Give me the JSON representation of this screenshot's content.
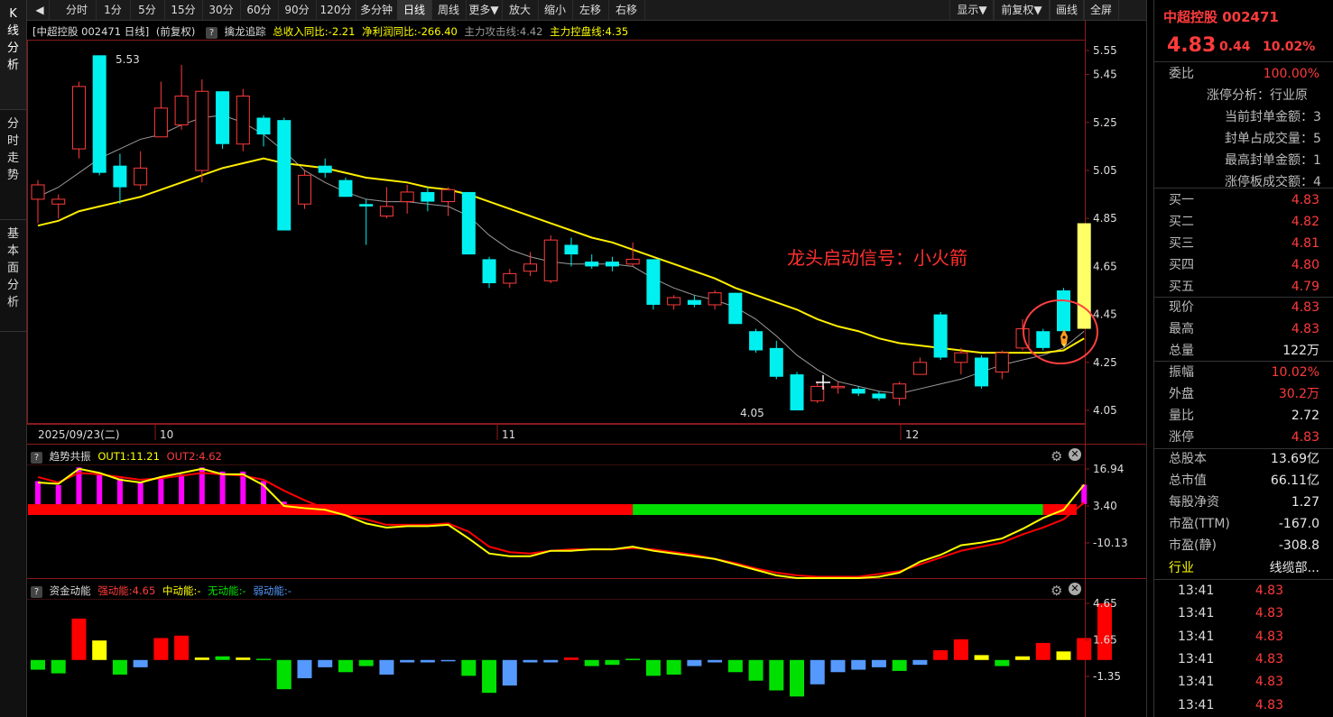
{
  "left_tabs": [
    "K线分析",
    "分时走势",
    "基本面分析"
  ],
  "toolbar": {
    "items": [
      "分时",
      "1分",
      "5分",
      "15分",
      "30分",
      "60分",
      "90分",
      "120分",
      "多分钟",
      "日线",
      "周线",
      "更多▼",
      "放大",
      "缩小",
      "左移",
      "右移"
    ],
    "right_items": [
      "显示▼",
      "前复权▼",
      "画线",
      "全屏"
    ],
    "active": "日线"
  },
  "main_header": {
    "title": "[中超控股 002471 日线]",
    "adjust": "(前复权)",
    "indicator": "擒龙追踪",
    "rev": "总收入同比:-2.21",
    "profit": "净利润同比:-266.40",
    "attack": "主力攻击线:4.42",
    "control": "主力控盘线:4.35"
  },
  "annotation": "龙头启动信号：小火箭",
  "price_axis": [
    "5.55",
    "5.45",
    "5.25",
    "5.05",
    "4.85",
    "4.65",
    "4.45",
    "4.25",
    "4.05"
  ],
  "high_label": "5.53",
  "low_label": "4.05",
  "date_axis": [
    "2025/09/23(二)",
    "10",
    "11",
    "12"
  ],
  "sub1_header": {
    "name": "趋势共振",
    "out1": "OUT1:11.21",
    "out2": "OUT2:4.62"
  },
  "sub1_axis": [
    "16.94",
    "3.40",
    "-10.13"
  ],
  "sub2_header": {
    "name": "资金动能",
    "strong": "强动能:4.65",
    "mid": "中动能:-",
    "none": "无动能:-",
    "weak": "弱动能:-"
  },
  "sub2_axis": [
    "4.65",
    "1.65",
    "-1.35"
  ],
  "colors": {
    "up": "#ff3b3b",
    "down": "#00f0f0",
    "ma_yellow": "#ffff00",
    "ma_gray": "#aaaaaa",
    "magenta": "#ff00ff",
    "green": "#00e000",
    "blue": "#5599ff"
  },
  "chart_data": {
    "type": "candlestick",
    "candles": [
      {
        "o": 4.93,
        "c": 4.99,
        "h": 5.01,
        "l": 4.83
      },
      {
        "o": 4.91,
        "c": 4.93,
        "h": 4.95,
        "l": 4.85
      },
      {
        "o": 5.14,
        "c": 5.4,
        "h": 5.42,
        "l": 5.1
      },
      {
        "o": 5.53,
        "c": 5.04,
        "h": 5.53,
        "l": 5.03
      },
      {
        "o": 5.07,
        "c": 4.98,
        "h": 5.12,
        "l": 4.91
      },
      {
        "o": 4.99,
        "c": 5.06,
        "h": 5.13,
        "l": 4.97
      },
      {
        "o": 5.19,
        "c": 5.31,
        "h": 5.42,
        "l": 5.19
      },
      {
        "o": 5.24,
        "c": 5.36,
        "h": 5.49,
        "l": 5.22
      },
      {
        "o": 5.05,
        "c": 5.38,
        "h": 5.43,
        "l": 5.0
      },
      {
        "o": 5.38,
        "c": 5.16,
        "h": 5.38,
        "l": 5.14
      },
      {
        "o": 5.16,
        "c": 5.36,
        "h": 5.39,
        "l": 5.13
      },
      {
        "o": 5.27,
        "c": 5.2,
        "h": 5.28,
        "l": 5.15
      },
      {
        "o": 5.26,
        "c": 4.8,
        "h": 5.27,
        "l": 4.8
      },
      {
        "o": 4.91,
        "c": 5.03,
        "h": 5.05,
        "l": 4.89
      },
      {
        "o": 5.07,
        "c": 5.04,
        "h": 5.1,
        "l": 5.02
      },
      {
        "o": 5.01,
        "c": 4.94,
        "h": 5.02,
        "l": 4.94
      },
      {
        "o": 4.91,
        "c": 4.9,
        "h": 4.93,
        "l": 4.74
      },
      {
        "o": 4.86,
        "c": 4.9,
        "h": 4.98,
        "l": 4.85
      },
      {
        "o": 4.92,
        "c": 4.96,
        "h": 4.99,
        "l": 4.87
      },
      {
        "o": 4.96,
        "c": 4.92,
        "h": 4.98,
        "l": 4.88
      },
      {
        "o": 4.92,
        "c": 4.97,
        "h": 4.98,
        "l": 4.86
      },
      {
        "o": 4.96,
        "c": 4.7,
        "h": 4.96,
        "l": 4.7
      },
      {
        "o": 4.68,
        "c": 4.58,
        "h": 4.69,
        "l": 4.56
      },
      {
        "o": 4.58,
        "c": 4.62,
        "h": 4.64,
        "l": 4.56
      },
      {
        "o": 4.63,
        "c": 4.66,
        "h": 4.71,
        "l": 4.61
      },
      {
        "o": 4.59,
        "c": 4.76,
        "h": 4.78,
        "l": 4.58
      },
      {
        "o": 4.74,
        "c": 4.7,
        "h": 4.77,
        "l": 4.65
      },
      {
        "o": 4.67,
        "c": 4.65,
        "h": 4.7,
        "l": 4.64
      },
      {
        "o": 4.67,
        "c": 4.65,
        "h": 4.69,
        "l": 4.63
      },
      {
        "o": 4.66,
        "c": 4.68,
        "h": 4.75,
        "l": 4.65
      },
      {
        "o": 4.68,
        "c": 4.49,
        "h": 4.68,
        "l": 4.47
      },
      {
        "o": 4.49,
        "c": 4.52,
        "h": 4.53,
        "l": 4.47
      },
      {
        "o": 4.51,
        "c": 4.49,
        "h": 4.53,
        "l": 4.48
      },
      {
        "o": 4.49,
        "c": 4.54,
        "h": 4.55,
        "l": 4.47
      },
      {
        "o": 4.54,
        "c": 4.41,
        "h": 4.54,
        "l": 4.41
      },
      {
        "o": 4.38,
        "c": 4.3,
        "h": 4.39,
        "l": 4.29
      },
      {
        "o": 4.31,
        "c": 4.19,
        "h": 4.34,
        "l": 4.18
      },
      {
        "o": 4.2,
        "c": 4.05,
        "h": 4.21,
        "l": 4.05
      },
      {
        "o": 4.09,
        "c": 4.15,
        "h": 4.17,
        "l": 4.08
      },
      {
        "o": 4.15,
        "c": 4.15,
        "h": 4.17,
        "l": 4.12
      },
      {
        "o": 4.14,
        "c": 4.12,
        "h": 4.15,
        "l": 4.11
      },
      {
        "o": 4.12,
        "c": 4.1,
        "h": 4.13,
        "l": 4.09
      },
      {
        "o": 4.1,
        "c": 4.16,
        "h": 4.17,
        "l": 4.07
      },
      {
        "o": 4.2,
        "c": 4.25,
        "h": 4.27,
        "l": 4.2
      },
      {
        "o": 4.45,
        "c": 4.27,
        "h": 4.46,
        "l": 4.26
      },
      {
        "o": 4.25,
        "c": 4.29,
        "h": 4.31,
        "l": 4.2
      },
      {
        "o": 4.27,
        "c": 4.15,
        "h": 4.28,
        "l": 4.14
      },
      {
        "o": 4.21,
        "c": 4.29,
        "h": 4.3,
        "l": 4.18
      },
      {
        "o": 4.31,
        "c": 4.39,
        "h": 4.43,
        "l": 4.3
      },
      {
        "o": 4.38,
        "c": 4.31,
        "h": 4.39,
        "l": 4.3
      },
      {
        "o": 4.55,
        "c": 4.38,
        "h": 4.56,
        "l": 4.37
      },
      {
        "o": 4.39,
        "c": 4.83,
        "h": 4.83,
        "l": 4.39
      }
    ],
    "ma_yellow": [
      4.82,
      4.84,
      4.88,
      4.9,
      4.92,
      4.94,
      4.97,
      5.0,
      5.03,
      5.06,
      5.08,
      5.1,
      5.08,
      5.07,
      5.06,
      5.04,
      5.02,
      5.01,
      5.0,
      4.98,
      4.97,
      4.95,
      4.92,
      4.89,
      4.86,
      4.83,
      4.8,
      4.77,
      4.75,
      4.72,
      4.69,
      4.66,
      4.63,
      4.6,
      4.56,
      4.53,
      4.5,
      4.47,
      4.43,
      4.4,
      4.38,
      4.35,
      4.33,
      4.32,
      4.31,
      4.3,
      4.29,
      4.29,
      4.29,
      4.29,
      4.3,
      4.35
    ],
    "ma_gray": [
      4.94,
      4.98,
      5.04,
      5.1,
      5.14,
      5.18,
      5.2,
      5.24,
      5.27,
      5.28,
      5.25,
      5.2,
      5.13,
      5.05,
      5.0,
      4.96,
      4.93,
      4.92,
      4.92,
      4.91,
      4.9,
      4.86,
      4.78,
      4.72,
      4.69,
      4.67,
      4.66,
      4.66,
      4.66,
      4.65,
      4.6,
      4.56,
      4.53,
      4.51,
      4.48,
      4.43,
      4.36,
      4.28,
      4.22,
      4.17,
      4.15,
      4.13,
      4.12,
      4.14,
      4.16,
      4.18,
      4.21,
      4.24,
      4.26,
      4.28,
      4.31,
      4.38
    ],
    "sub1": {
      "magenta_bars": [
        12.5,
        11.0,
        17.5,
        15.5,
        13.5,
        12.0,
        14.0,
        15.0,
        17.5,
        16.0,
        16.0,
        12.5,
        5.0,
        null,
        null,
        null,
        null,
        null,
        null,
        null,
        null,
        null,
        null,
        null,
        null,
        null,
        null,
        null,
        null,
        null,
        null,
        null,
        null,
        null,
        null,
        null,
        null,
        null,
        null,
        null,
        null,
        null,
        null,
        null,
        null,
        null,
        null,
        null,
        null,
        null,
        null,
        11.21
      ],
      "line_yellow": [
        12.0,
        11.5,
        17.0,
        15.5,
        13.0,
        12.0,
        14.0,
        15.5,
        17.0,
        15.0,
        15.0,
        11.0,
        3.4,
        2.6,
        2.0,
        0.0,
        -3.0,
        -4.5,
        -4.0,
        -4.0,
        -3.5,
        -8.5,
        -14.0,
        -15.0,
        -15.0,
        -13.0,
        -13.0,
        -12.5,
        -12.5,
        -11.5,
        -13.0,
        -14.0,
        -15.0,
        -16.0,
        -18.0,
        -20.0,
        -22.0,
        -23.0,
        -23.0,
        -23.0,
        -23.0,
        -22.5,
        -21.0,
        -17.0,
        -14.5,
        -11.0,
        -10.0,
        -8.5,
        -5.0,
        -1.0,
        2.0,
        11.21
      ],
      "line_red": [
        14.0,
        12.0,
        15.5,
        15.0,
        14.0,
        13.0,
        13.5,
        14.5,
        15.5,
        15.0,
        14.5,
        13.0,
        9.0,
        5.5,
        2.5,
        0.0,
        -1.5,
        -3.5,
        -3.5,
        -3.5,
        -3.0,
        -6.0,
        -11.5,
        -13.5,
        -14.0,
        -13.0,
        -12.5,
        -12.5,
        -12.5,
        -12.0,
        -12.5,
        -13.5,
        -14.5,
        -16.0,
        -17.5,
        -19.5,
        -21.0,
        -22.0,
        -22.5,
        -22.5,
        -22.5,
        -21.5,
        -20.5,
        -18.0,
        -15.5,
        -13.0,
        -11.5,
        -10.0,
        -7.0,
        -4.5,
        -1.5,
        4.62
      ],
      "band_red_end": 29,
      "band_green_end": 49
    },
    "sub2": {
      "bars": [
        {
          "v": -0.8,
          "c": "green"
        },
        {
          "v": -1.1,
          "c": "green"
        },
        {
          "v": 3.4,
          "c": "red"
        },
        {
          "v": 1.6,
          "c": "yellow"
        },
        {
          "v": -1.2,
          "c": "green"
        },
        {
          "v": -0.6,
          "c": "blue"
        },
        {
          "v": 1.8,
          "c": "red"
        },
        {
          "v": 2.0,
          "c": "red"
        },
        {
          "v": 0.2,
          "c": "yellow"
        },
        {
          "v": 0.3,
          "c": "green"
        },
        {
          "v": 0.2,
          "c": "yellow"
        },
        {
          "v": 0.1,
          "c": "green"
        },
        {
          "v": -2.4,
          "c": "green"
        },
        {
          "v": -1.5,
          "c": "blue"
        },
        {
          "v": -0.6,
          "c": "blue"
        },
        {
          "v": -1.0,
          "c": "green"
        },
        {
          "v": -0.5,
          "c": "green"
        },
        {
          "v": -1.2,
          "c": "blue"
        },
        {
          "v": -0.2,
          "c": "blue"
        },
        {
          "v": -0.2,
          "c": "blue"
        },
        {
          "v": -0.1,
          "c": "blue"
        },
        {
          "v": -1.3,
          "c": "green"
        },
        {
          "v": -2.7,
          "c": "green"
        },
        {
          "v": -2.1,
          "c": "blue"
        },
        {
          "v": -0.2,
          "c": "blue"
        },
        {
          "v": -0.2,
          "c": "blue"
        },
        {
          "v": 0.2,
          "c": "red"
        },
        {
          "v": -0.5,
          "c": "green"
        },
        {
          "v": -0.4,
          "c": "green"
        },
        {
          "v": 0.1,
          "c": "green"
        },
        {
          "v": -1.3,
          "c": "green"
        },
        {
          "v": -1.2,
          "c": "green"
        },
        {
          "v": -0.5,
          "c": "blue"
        },
        {
          "v": -0.2,
          "c": "blue"
        },
        {
          "v": -1.0,
          "c": "green"
        },
        {
          "v": -1.7,
          "c": "green"
        },
        {
          "v": -2.5,
          "c": "green"
        },
        {
          "v": -3.0,
          "c": "green"
        },
        {
          "v": -2.0,
          "c": "blue"
        },
        {
          "v": -1.0,
          "c": "blue"
        },
        {
          "v": -0.8,
          "c": "blue"
        },
        {
          "v": -0.6,
          "c": "blue"
        },
        {
          "v": -0.9,
          "c": "green"
        },
        {
          "v": -0.4,
          "c": "blue"
        },
        {
          "v": 0.8,
          "c": "red"
        },
        {
          "v": 1.7,
          "c": "red"
        },
        {
          "v": 0.4,
          "c": "yellow"
        },
        {
          "v": -0.5,
          "c": "green"
        },
        {
          "v": 0.3,
          "c": "yellow"
        },
        {
          "v": 1.4,
          "c": "red"
        },
        {
          "v": 0.7,
          "c": "yellow"
        },
        {
          "v": 1.8,
          "c": "red"
        },
        {
          "v": 4.65,
          "c": "red"
        }
      ]
    }
  },
  "quote": {
    "name": "中超控股",
    "code": "002471",
    "price": "4.83",
    "change": "0.44",
    "pct": "10.02%",
    "weibi_k": "委比",
    "weibi_v": "100.00%",
    "limit_rows": [
      "涨停分析：行业原",
      "当前封单金额：3",
      "封单占成交量：5",
      "最高封单金额：1",
      "涨停板成交额：4"
    ],
    "buy": [
      {
        "k": "买一",
        "v": "4.83"
      },
      {
        "k": "买二",
        "v": "4.82"
      },
      {
        "k": "买三",
        "v": "4.81"
      },
      {
        "k": "买四",
        "v": "4.80"
      },
      {
        "k": "买五",
        "v": "4.79"
      }
    ],
    "stats1": [
      {
        "k": "现价",
        "v": "4.83",
        "c": "red"
      },
      {
        "k": "最高",
        "v": "4.83",
        "c": "red"
      },
      {
        "k": "总量",
        "v": "122万",
        "c": "white"
      }
    ],
    "stats2": [
      {
        "k": "振幅",
        "v": "10.02%",
        "c": "red"
      },
      {
        "k": "外盘",
        "v": "30.2万",
        "c": "red"
      },
      {
        "k": "量比",
        "v": "2.72",
        "c": "white"
      },
      {
        "k": "涨停",
        "v": "4.83",
        "c": "red"
      }
    ],
    "fund": [
      {
        "k": "总股本",
        "v": "13.69亿"
      },
      {
        "k": "总市值",
        "v": "66.11亿"
      },
      {
        "k": "每股净资",
        "v": "1.27"
      },
      {
        "k": "市盈(TTM)",
        "v": "-167.0"
      },
      {
        "k": "市盈(静)",
        "v": "-308.8"
      }
    ],
    "industry_k": "行业",
    "industry_v": "线缆部...",
    "ticks": [
      {
        "t": "13:41",
        "p": "4.83"
      },
      {
        "t": "13:41",
        "p": "4.83"
      },
      {
        "t": "13:41",
        "p": "4.83"
      },
      {
        "t": "13:41",
        "p": "4.83"
      },
      {
        "t": "13:41",
        "p": "4.83"
      },
      {
        "t": "13:41",
        "p": "4.83"
      }
    ]
  }
}
